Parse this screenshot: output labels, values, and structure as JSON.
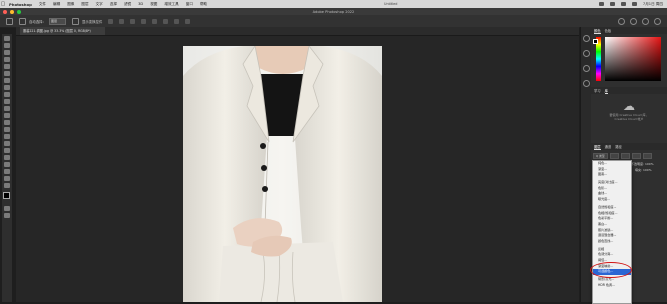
{
  "menubar": {
    "app": "Photoshop",
    "items": [
      "文件",
      "编辑",
      "图像",
      "图层",
      "文字",
      "选择",
      "滤镜",
      "3D",
      "视图",
      "增效工具",
      "窗口",
      "帮助"
    ],
    "center": "Untitled",
    "clock": "7月1日 周四"
  },
  "window": {
    "title": "Adobe Photoshop 2022"
  },
  "options": {
    "mode_label": "自动选择：",
    "mode_value": "图层",
    "transform_label": "显示变换控件"
  },
  "document": {
    "tab": "服装221-调图.jpg @ 33.3% (图层 0, RGB/8*)"
  },
  "panels": {
    "tabs": [
      "颜色",
      "色板"
    ],
    "props_tabs": [
      "学习",
      "库"
    ],
    "cloud_text": [
      "要使用 Creative Cloud 库，",
      "Creative Cloud 帐户"
    ],
    "layers_tabs": [
      "图层",
      "通道",
      "路径"
    ],
    "kind": "Q 类型",
    "opacity_label": "不透明度: 100%",
    "fill_label": "填充: 100%",
    "normal": "正常",
    "lock": "锁定:"
  },
  "context_menu": {
    "items": [
      {
        "label": "纯色..."
      },
      {
        "label": "渐变..."
      },
      {
        "label": "图案..."
      },
      {
        "sep": true
      },
      {
        "label": "亮度/对比度..."
      },
      {
        "label": "色阶..."
      },
      {
        "label": "曲线..."
      },
      {
        "label": "曝光度..."
      },
      {
        "sep": true
      },
      {
        "label": "自然饱和度..."
      },
      {
        "label": "色相/饱和度..."
      },
      {
        "label": "色彩平衡..."
      },
      {
        "label": "黑白..."
      },
      {
        "label": "照片滤镜..."
      },
      {
        "label": "通道混合器..."
      },
      {
        "label": "颜色查找..."
      },
      {
        "sep": true
      },
      {
        "label": "反相"
      },
      {
        "label": "色调分离..."
      },
      {
        "label": "阈值..."
      },
      {
        "label": "渐变映射..."
      },
      {
        "label": "可选颜色...",
        "active": true
      },
      {
        "sep": true
      },
      {
        "label": "阴影/高光..."
      },
      {
        "label": "HDR 色调..."
      }
    ]
  },
  "colors": {
    "highlight": "#2b66d3",
    "annotation": "#d21515",
    "picker_hue": "#e51414"
  }
}
